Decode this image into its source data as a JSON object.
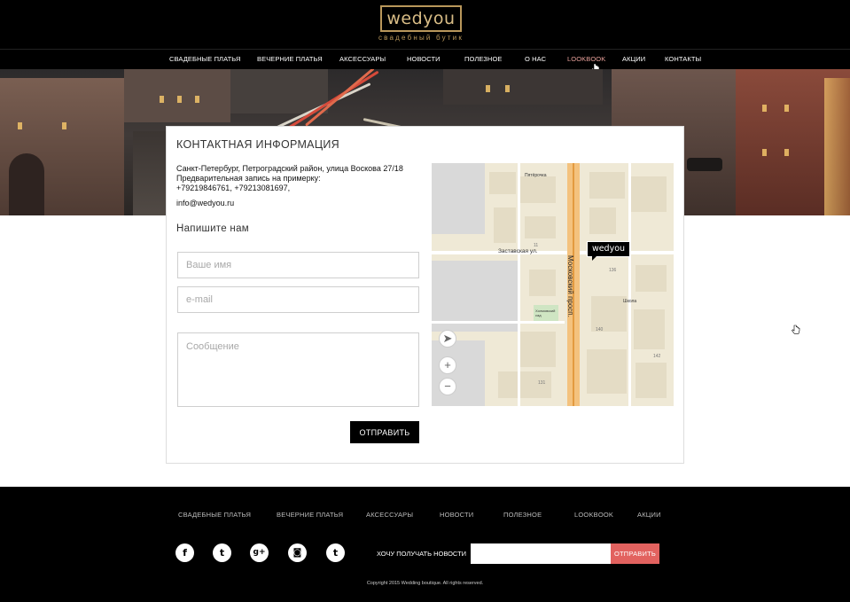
{
  "header": {
    "logo_text": "wedyou",
    "tagline": "свадебный бутик",
    "nav": [
      {
        "label": "СВАДЕБНЫЕ ПЛАТЬЯ"
      },
      {
        "label": "ВЕЧЕРНИЕ ПЛАТЬЯ"
      },
      {
        "label": "АКСЕССУАРЫ"
      },
      {
        "label": "НОВОСТИ"
      },
      {
        "label": "ПОЛЕЗНОЕ"
      },
      {
        "label": "О НАС"
      },
      {
        "label": "LOOKBOOK",
        "active": true
      },
      {
        "label": "АКЦИИ"
      },
      {
        "label": "КОНТАКТЫ"
      }
    ],
    "active_color": "#e7a09a"
  },
  "contact": {
    "title": "КОНТАКТНАЯ ИНФОРМАЦИЯ",
    "address": "Санкт-Петербург, Петроградский район, улица Воскова 27/18",
    "appointment": "Предварительная запись на примерку:",
    "phones": "+79219846761, +79213081697,",
    "email": "info@wedyou.ru"
  },
  "form": {
    "heading": "Напишите нам",
    "name_placeholder": "Ваше имя",
    "email_placeholder": "e-mail",
    "message_placeholder": "Сообщение",
    "submit_label": "ОТПРАВИТЬ"
  },
  "map": {
    "marker_label": "wedyou",
    "street_zastavskaya": "Заставская ул.",
    "street_moskovsky": "Московский просп.",
    "label_pyaterochka": "Пятёрочка",
    "label_school": "Школа",
    "label_square": "Холмовский сад",
    "controls": {
      "locate": "➤",
      "zoom_in": "+",
      "zoom_out": "−"
    }
  },
  "footer": {
    "nav": [
      {
        "label": "СВАДЕБНЫЕ ПЛАТЬЯ"
      },
      {
        "label": "ВЕЧЕРНИЕ ПЛАТЬЯ"
      },
      {
        "label": "АКСЕССУАРЫ"
      },
      {
        "label": "НОВОСТИ"
      },
      {
        "label": "ПОЛЕЗНОЕ"
      },
      {
        "label": "LOOKBOOK"
      },
      {
        "label": "АКЦИИ"
      }
    ],
    "social": [
      {
        "name": "facebook-icon",
        "glyph": "f"
      },
      {
        "name": "twitter-icon",
        "glyph": "t"
      },
      {
        "name": "google-plus-icon",
        "glyph": "g+"
      },
      {
        "name": "instagram-icon",
        "glyph": "◙"
      },
      {
        "name": "tumblr-icon",
        "glyph": "t"
      }
    ],
    "subscribe_label": "ХОЧУ ПОЛУЧАТЬ НОВОСТИ",
    "subscribe_button": "ОТПРАВИТЬ",
    "subscribe_button_color": "#e2625f",
    "copyright": "Copyright 2015 Wedding boutique. All rights reserved."
  }
}
